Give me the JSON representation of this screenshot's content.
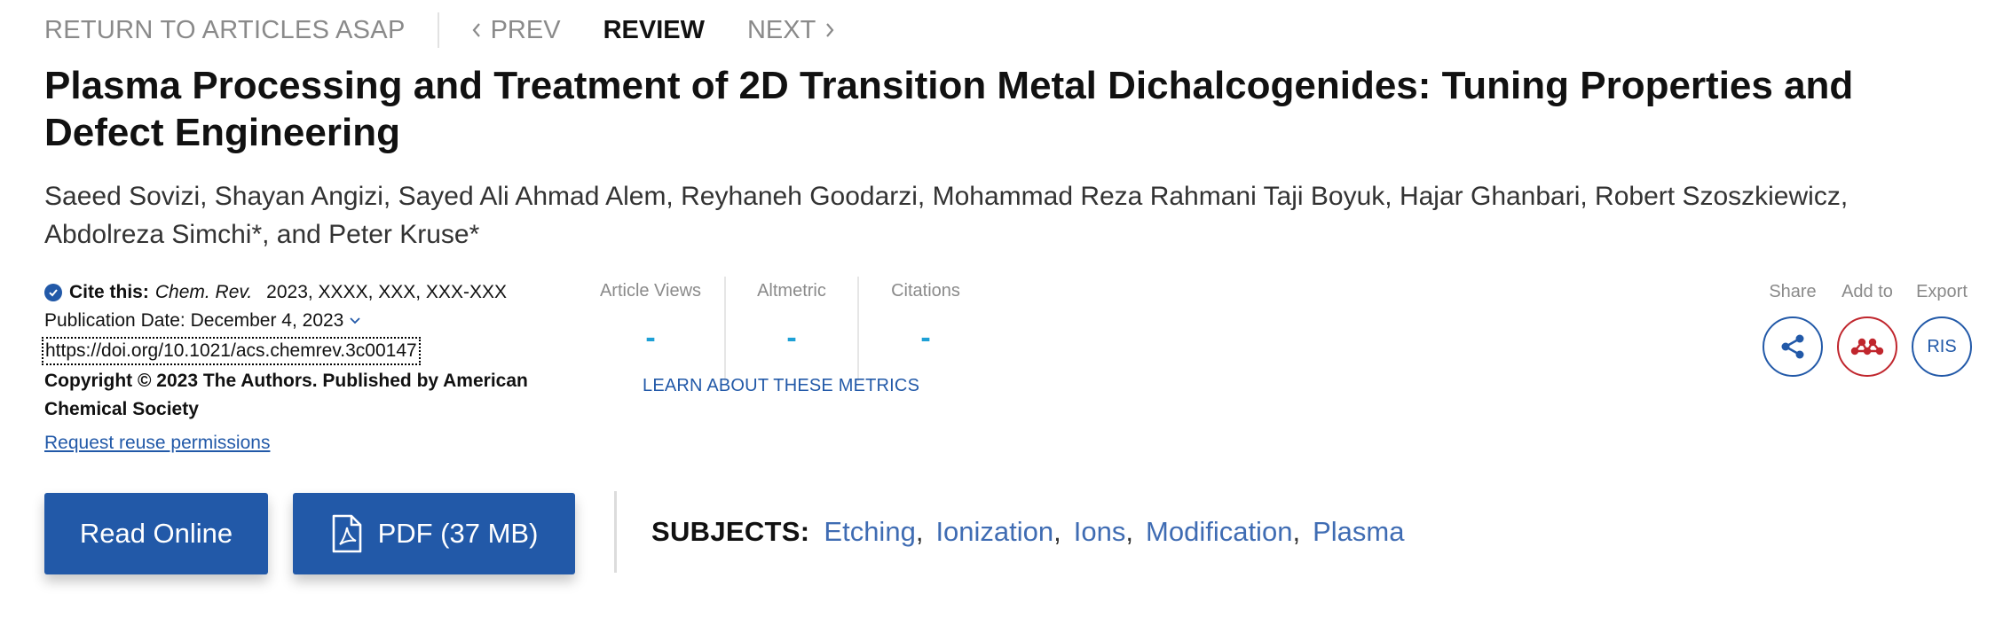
{
  "nav": {
    "return_label": "RETURN TO ARTICLES ASAP",
    "prev_label": "PREV",
    "current_label": "REVIEW",
    "next_label": "NEXT"
  },
  "article": {
    "title": "Plasma Processing and Treatment of 2D Transition Metal Dichalcogenides: Tuning Properties and Defect Engineering",
    "authors": "Saeed Sovizi, Shayan Angizi, Sayed Ali Ahmad Alem, Reyhaneh Goodarzi, Mohammad Reza Rahmani Taji Boyuk, Hajar Ghanbari, Robert Szoszkiewicz, Abdolreza Simchi*, and Peter Kruse*"
  },
  "citation": {
    "cite_label": "Cite this:",
    "journal": "Chem. Rev.",
    "details": "2023, XXXX, XXX, XXX-XXX",
    "publication_date": "Publication Date: December 4, 2023",
    "doi": "https://doi.org/10.1021/acs.chemrev.3c00147",
    "copyright": "Copyright © 2023 The Authors. Published by American Chemical Society",
    "reuse_link": "Request reuse permissions"
  },
  "metrics": {
    "items": [
      {
        "label": "Article Views",
        "value": "-"
      },
      {
        "label": "Altmetric",
        "value": "-"
      },
      {
        "label": "Citations",
        "value": "-"
      }
    ],
    "learn_link": "LEARN ABOUT THESE METRICS"
  },
  "tools": {
    "share_label": "Share",
    "add_label": "Add to",
    "export_label": "Export",
    "export_button": "RIS",
    "share_icon": "share-icon",
    "add_icon": "mendeley-icon"
  },
  "actions": {
    "read_label": "Read Online",
    "pdf_label": "PDF (37 MB)",
    "pdf_icon": "pdf-icon"
  },
  "subjects": {
    "label": "SUBJECTS:",
    "items": [
      "Etching",
      "Ionization",
      "Ions",
      "Modification",
      "Plasma"
    ]
  },
  "colors": {
    "brand_blue": "#2259a8",
    "metric_value": "#1ea0d6",
    "mendeley_red": "#c0262d",
    "muted_text": "#8a8a8a"
  }
}
